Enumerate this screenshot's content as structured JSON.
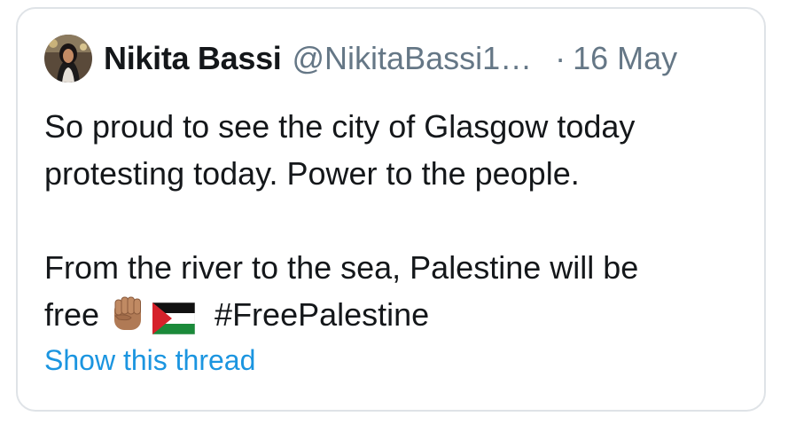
{
  "tweet": {
    "author_name": "Nikita Bassi",
    "handle": "@NikitaBassi1…",
    "separator": "·",
    "date": "16 May",
    "avatar": "profile-photo",
    "line1": "So proud to see the city of Glasgow today",
    "line2": "protesting today. Power to the people.",
    "line3": "From the river to the sea, Palestine will be",
    "line4_text": "free",
    "emojis": [
      "raised-fist-medium-skin-tone",
      "palestine-flag"
    ],
    "hashtag": "#FreePalestine",
    "show_thread": "Show this thread"
  },
  "colors": {
    "text": "#14171a",
    "secondary": "#657786",
    "link": "#1b95e0",
    "border": "#dfe3e7"
  }
}
